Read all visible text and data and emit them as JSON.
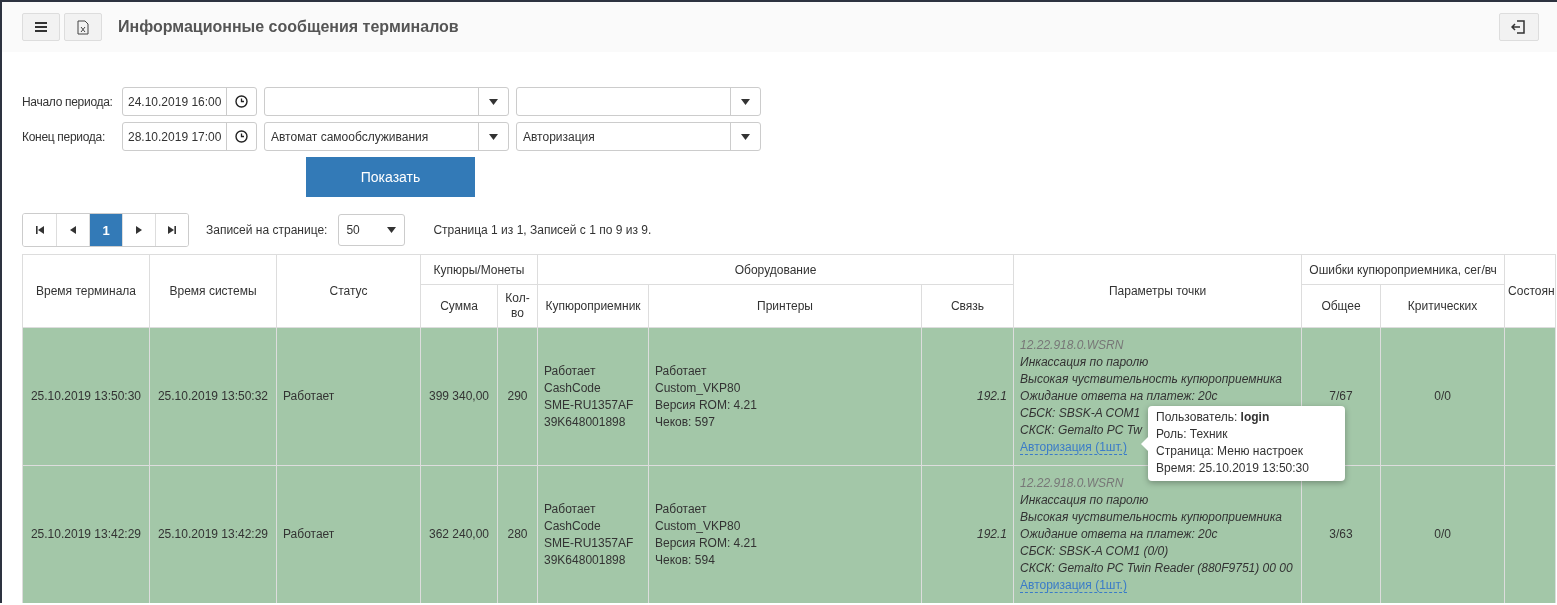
{
  "header": {
    "title": "Информационные сообщения терминалов"
  },
  "filters": [
    {
      "label": "Начало периода:",
      "date": "24.10.2019 16:00",
      "selects": [
        {
          "kind": "dropdown"
        },
        {
          "kind": "dropdown"
        }
      ]
    },
    {
      "label": "Конец периода:",
      "date": "28.10.2019 17:00",
      "selects": [
        {
          "kind": "dropdown",
          "value": "Автомат самообслуживания"
        },
        {
          "kind": "dropdown",
          "value": "Авторизация"
        }
      ]
    }
  ],
  "show_button": "Показать",
  "pagination": {
    "pages": [
      {
        "label": "1",
        "selected": true
      }
    ],
    "per_page_label": "Записей на странице:",
    "per_page": "50",
    "info": "Страница 1 из 1, Записей с 1 по 9 из 9."
  },
  "table": {
    "columns": [
      {
        "label": "Время терминала"
      },
      {
        "label": "Время системы"
      },
      {
        "label": "Статус"
      },
      {
        "group": "Купюры/Монеты",
        "columns": [
          {
            "label": "Сумма"
          },
          {
            "label": "Кол-во"
          }
        ]
      },
      {
        "group": "Оборудование",
        "columns": [
          {
            "label": "Купюроприемник"
          },
          {
            "label": "Принтеры"
          },
          {
            "label": "Связь"
          }
        ]
      },
      {
        "label": "Параметры точки"
      },
      {
        "group": "Ошибки купюроприемника, сег/вч",
        "columns": [
          {
            "label": "Общее"
          },
          {
            "label": "Критических"
          }
        ]
      },
      {
        "label": "Состоян"
      }
    ],
    "rows": [
      {
        "terminal_time": "25.10.2019 13:50:30",
        "system_time": "25.10.2019 13:50:32",
        "status": "Работает",
        "sum": "399 340,00",
        "count": "290",
        "acceptor": [
          "Работает",
          "CashCode",
          "SME-RU1357AF",
          "39K648001898"
        ],
        "printers": [
          "Работает",
          "Custom_VKP80",
          "Версия ROM: 4.21",
          "Чеков: 597"
        ],
        "connection": "192.1",
        "params": [
          {
            "kind": "version",
            "text": "12.22.918.0.WSRN"
          },
          {
            "kind": "text",
            "text": "Инкассация по паролю"
          },
          {
            "kind": "text",
            "text": "Высокая чуствительность купюроприемника"
          },
          {
            "kind": "text",
            "text": "Ожидание ответа на платеж: 20с"
          },
          {
            "kind": "text",
            "text": "СБСК: SBSK-A COM1"
          },
          {
            "kind": "text",
            "text": "СКСК: Gemalto PC Tw"
          },
          {
            "kind": "link",
            "text": "Авторизация (1шт.)"
          }
        ],
        "errors_total": "7/67",
        "errors_critical": "0/0",
        "tooltip": [
          "Пользователь: **login**",
          "Роль: Техник",
          "Страница: Меню настроек",
          "Время: 25.10.2019 13:50:30"
        ]
      },
      {
        "terminal_time": "25.10.2019 13:42:29",
        "system_time": "25.10.2019 13:42:29",
        "status": "Работает",
        "sum": "362 240,00",
        "count": "280",
        "acceptor": [
          "Работает",
          "CashCode",
          "SME-RU1357AF",
          "39K648001898"
        ],
        "printers": [
          "Работает",
          "Custom_VKP80",
          "Версия ROM: 4.21",
          "Чеков: 594"
        ],
        "connection": "192.1",
        "params": [
          {
            "kind": "version",
            "text": "12.22.918.0.WSRN"
          },
          {
            "kind": "text",
            "text": "Инкассация по паролю"
          },
          {
            "kind": "text",
            "text": "Высокая чуствительность купюроприемника"
          },
          {
            "kind": "text",
            "text": "Ожидание ответа на платеж: 20с"
          },
          {
            "kind": "text",
            "text": "СБСК: SBSK-A COM1 (0/0)"
          },
          {
            "kind": "text",
            "text": "СКСК: Gemalto PC Twin Reader (880F9751) 00 00"
          },
          {
            "kind": "link",
            "text": "Авторизация (1шт.)"
          }
        ],
        "errors_total": "3/63",
        "errors_critical": "0/0"
      }
    ]
  }
}
